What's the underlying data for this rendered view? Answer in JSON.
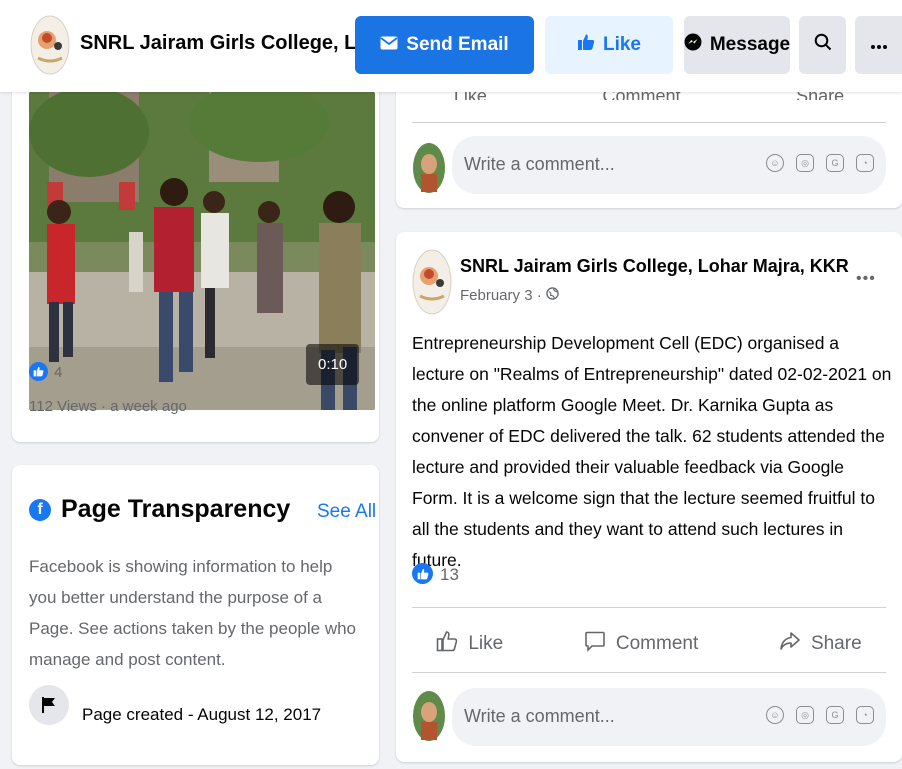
{
  "header": {
    "title": "SNRL Jairam Girls College, Loh...",
    "send_email_label": "Send Email",
    "like_label": "Like",
    "message_label": "Message"
  },
  "video_card": {
    "duration": "0:10",
    "like_count": "4",
    "meta": "112 Views · a week ago"
  },
  "transparency": {
    "title": "Page Transparency",
    "see_all": "See All",
    "description": "Facebook is showing information to help you better understand the purpose of a Page. See actions taken by the people who manage and post content.",
    "page_created": "Page created - August 12, 2017"
  },
  "top_card": {
    "partial_actions": [
      "Like",
      "Comment",
      "Share"
    ],
    "comment_placeholder": "Write a comment..."
  },
  "post": {
    "author": "SNRL Jairam Girls College, Lohar Majra, KKR",
    "date": "February 3 ·",
    "more": "•••",
    "body": "Entrepreneurship Development Cell (EDC) organised a lecture on \"Realms of Entrepreneurship\" dated 02-02-2021 on the online platform Google Meet. Dr. Karnika Gupta as convener of EDC delivered the talk. 62 students attended the lecture and provided their valuable feedback via Google Form. It is a welcome sign that the lecture seemed fruitful to all the students and they want to attend such lectures in future.",
    "like_count": "13",
    "actions": {
      "like": "Like",
      "comment": "Comment",
      "share": "Share"
    },
    "comment_placeholder": "Write a comment..."
  },
  "colors": {
    "brand_blue": "#1877f2",
    "email_button": "#1b74e4",
    "like_button_bg": "#e7f3ff",
    "secondary_bg": "#e4e6eb",
    "page_bg": "#f0f2f5"
  },
  "icons": [
    "envelope-icon",
    "thumbs-up-icon",
    "messenger-icon",
    "search-icon",
    "more-icon",
    "globe-icon",
    "facebook-icon",
    "flag-icon",
    "comment-icon",
    "share-icon",
    "emoji-icon",
    "camera-icon",
    "gif-icon",
    "sticker-icon"
  ]
}
